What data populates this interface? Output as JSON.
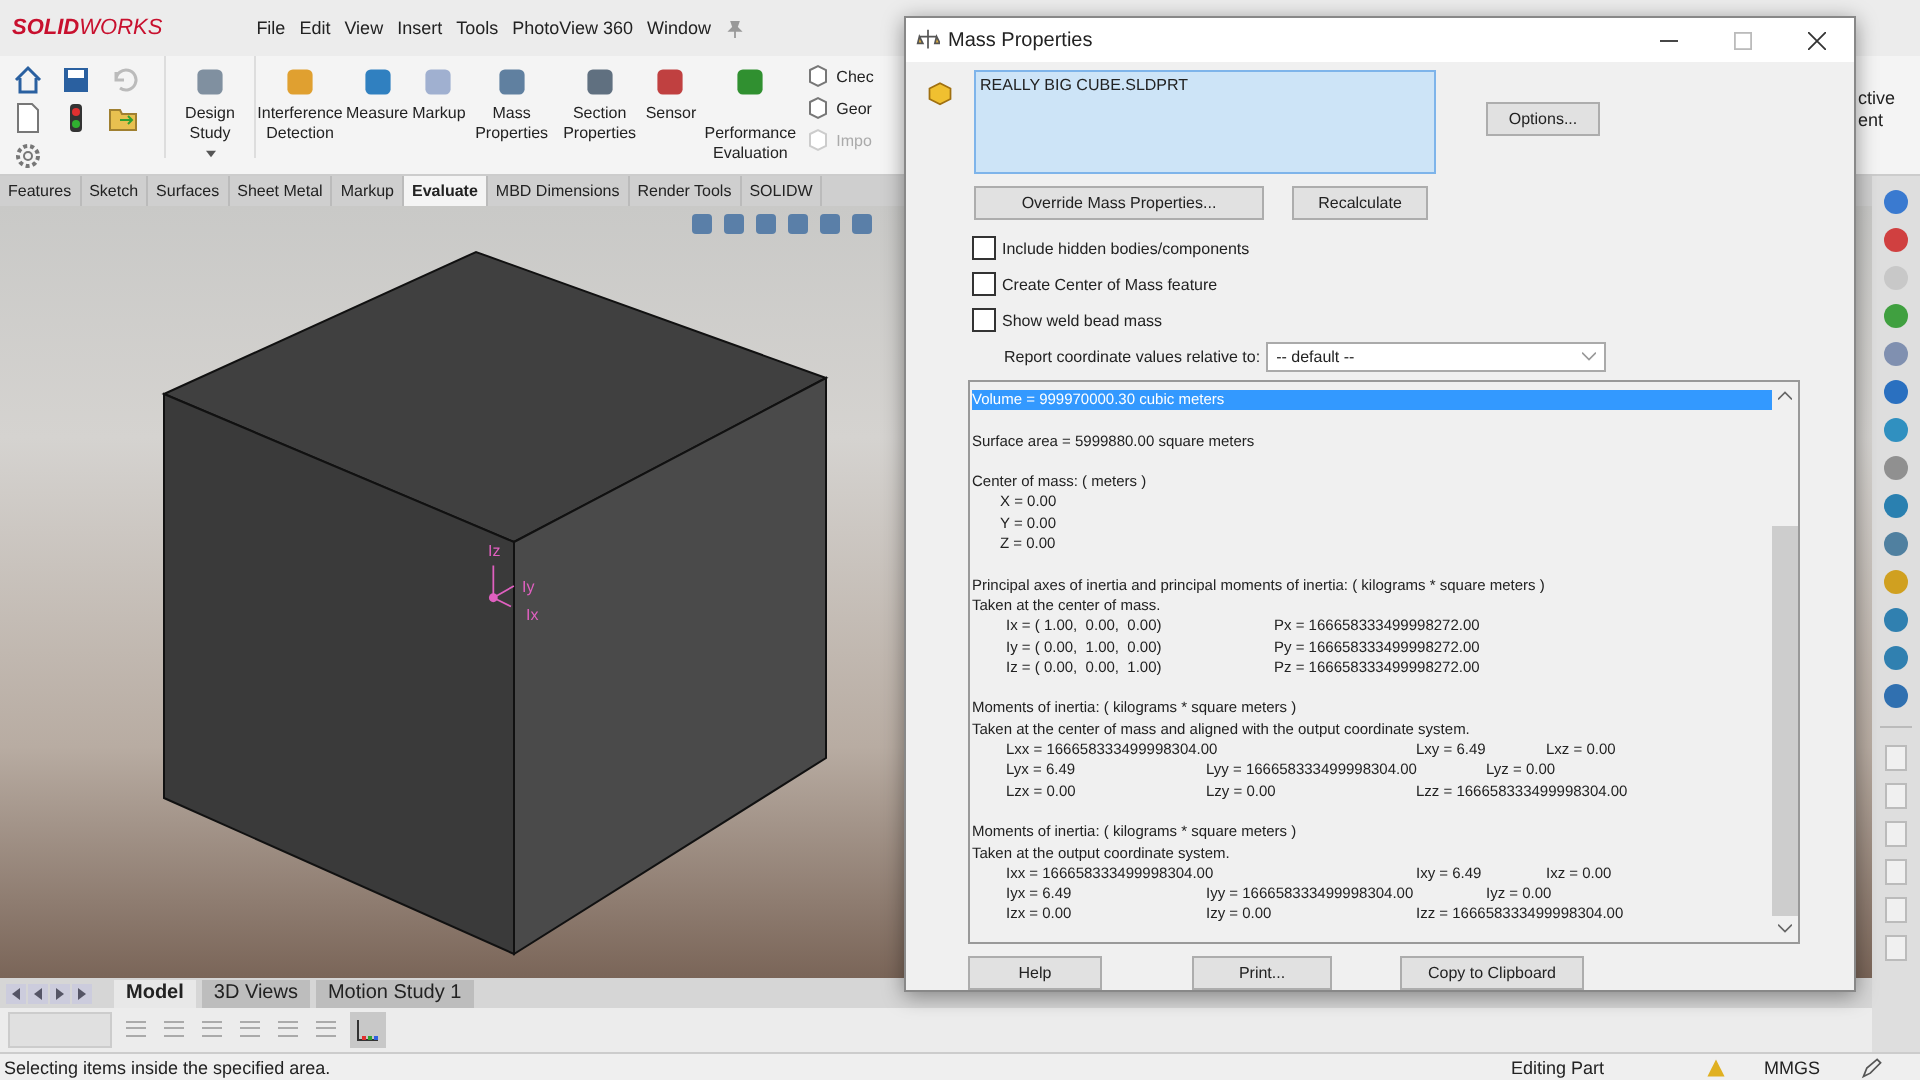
{
  "app": {
    "logo": "SOLIDWORKS",
    "menu": [
      "File",
      "Edit",
      "View",
      "Insert",
      "Tools",
      "PhotoView 360",
      "Window"
    ]
  },
  "ribbon": {
    "tools": [
      {
        "label": "Design Study",
        "dropdown": true
      },
      {
        "label": "Interference Detection",
        "dropdown": false
      },
      {
        "label": "Measure",
        "dropdown": false
      },
      {
        "label": "Markup",
        "dropdown": false
      },
      {
        "label": "Mass Properties",
        "dropdown": false
      },
      {
        "label": "Section Properties",
        "dropdown": false
      },
      {
        "label": "Sensor",
        "dropdown": false
      },
      {
        "label": "Performance Evaluation",
        "dropdown": false
      }
    ],
    "side_items": [
      {
        "label": "Chec",
        "disabled": false
      },
      {
        "label": "Geor",
        "disabled": false
      },
      {
        "label": "Impo",
        "disabled": true
      }
    ],
    "right_labels": [
      "ctive",
      "ent"
    ]
  },
  "tabs": [
    {
      "label": "Features",
      "selected": false
    },
    {
      "label": "Sketch",
      "selected": false
    },
    {
      "label": "Surfaces",
      "selected": false
    },
    {
      "label": "Sheet Metal",
      "selected": false
    },
    {
      "label": "Markup",
      "selected": false
    },
    {
      "label": "Evaluate",
      "selected": true
    },
    {
      "label": "MBD Dimensions",
      "selected": false
    },
    {
      "label": "Render Tools",
      "selected": false
    },
    {
      "label": "SOLIDW",
      "selected": false
    }
  ],
  "viewport": {
    "triad_labels": [
      "Iz",
      "Iy",
      "Ix"
    ]
  },
  "bottom_tabs": [
    {
      "label": "Model",
      "selected": true
    },
    {
      "label": "3D Views",
      "selected": false
    },
    {
      "label": "Motion Study 1",
      "selected": false
    }
  ],
  "status_bar": {
    "message": "Selecting items inside the specified area.",
    "mode": "Editing Part",
    "units": "MMGS"
  },
  "dialog": {
    "title": "Mass Properties",
    "selection": [
      "REALLY BIG CUBE.SLDPRT"
    ],
    "options_button": "Options...",
    "override_button": "Override Mass Properties...",
    "recalculate_button": "Recalculate",
    "checkboxes": [
      {
        "label": "Include hidden bodies/components",
        "checked": false
      },
      {
        "label": "Create Center of Mass feature",
        "checked": false
      },
      {
        "label": "Show weld bead mass",
        "checked": false
      }
    ],
    "coord_label": "Report coordinate values relative to:",
    "coord_value": "-- default --",
    "report": [
      {
        "selected": true,
        "lines": [
          {
            "kind": "text",
            "cells": [
              "Volume = 999970000.30 cubic meters"
            ]
          }
        ]
      },
      {
        "selected": false,
        "lines": [
          {
            "kind": "text",
            "cells": [
              "Surface area = 5999880.00 square meters"
            ]
          }
        ]
      },
      {
        "selected": false,
        "lines": [
          {
            "kind": "text",
            "cells": [
              "Center of mass: ( meters )"
            ]
          },
          {
            "kind": "indent",
            "cells": [
              "X = 0.00"
            ]
          },
          {
            "kind": "indent",
            "cells": [
              "Y = 0.00"
            ]
          },
          {
            "kind": "indent",
            "cells": [
              "Z = 0.00"
            ]
          }
        ]
      },
      {
        "selected": false,
        "lines": [
          {
            "kind": "text",
            "cells": [
              "Principal axes of inertia and principal moments of inertia: ( kilograms * square meters )"
            ]
          },
          {
            "kind": "text",
            "cells": [
              "Taken at the center of mass."
            ]
          },
          {
            "kind": "pair",
            "cells": [
              "Ix = ( 1.00,  0.00,  0.00)",
              "Px = 166658333499998272.00"
            ]
          },
          {
            "kind": "pair",
            "cells": [
              "Iy = ( 0.00,  1.00,  0.00)",
              "Py = 166658333499998272.00"
            ]
          },
          {
            "kind": "pair",
            "cells": [
              "Iz = ( 0.00,  0.00,  1.00)",
              "Pz = 166658333499998272.00"
            ]
          }
        ]
      },
      {
        "selected": false,
        "lines": [
          {
            "kind": "text",
            "cells": [
              "Moments of inertia: ( kilograms * square meters )"
            ]
          },
          {
            "kind": "text",
            "cells": [
              "Taken at the center of mass and aligned with the output coordinate system."
            ]
          },
          {
            "kind": "xrow",
            "cells": [
              "Lxx = 166658333499998304.00",
              "Lxy = 6.49",
              "Lxz = 0.00"
            ]
          },
          {
            "kind": "yrow",
            "cells": [
              "Lyx = 6.49",
              "Lyy = 166658333499998304.00",
              "Lyz = 0.00"
            ]
          },
          {
            "kind": "zrow",
            "cells": [
              "Lzx = 0.00",
              "Lzy = 0.00",
              "Lzz = 166658333499998304.00"
            ]
          }
        ]
      },
      {
        "selected": false,
        "lines": [
          {
            "kind": "text",
            "cells": [
              "Moments of inertia: ( kilograms * square meters )"
            ]
          },
          {
            "kind": "text",
            "cells": [
              "Taken at the output coordinate system."
            ]
          },
          {
            "kind": "xrow",
            "cells": [
              "Ixx = 166658333499998304.00",
              "Ixy = 6.49",
              "Ixz = 0.00"
            ]
          },
          {
            "kind": "yrow",
            "cells": [
              "Iyx = 6.49",
              "Iyy = 166658333499998304.00",
              "Iyz = 0.00"
            ]
          },
          {
            "kind": "zrow",
            "cells": [
              "Izx = 0.00",
              "Izy = 0.00",
              "Izz = 166658333499998304.00"
            ]
          }
        ]
      }
    ],
    "buttons": [
      "Help",
      "Print...",
      "Copy to Clipboard"
    ]
  }
}
